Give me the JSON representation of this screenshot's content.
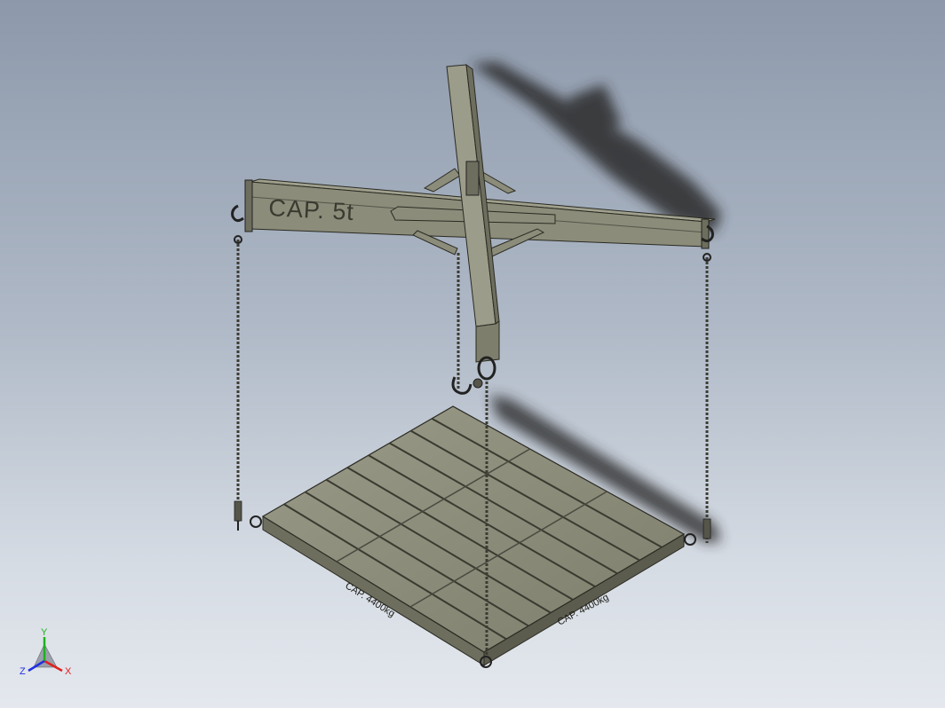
{
  "viewport": {
    "background_top": "#8d99ab",
    "background_bottom": "#e4e8ee"
  },
  "model": {
    "beam_capacity_label": "CAP. 5t",
    "plate_capacity_label_left": "CAP. 4400kg",
    "plate_capacity_label_right": "CAP. 4400kg",
    "steel_color": "#8c8c7a",
    "steel_dark": "#5e5e50",
    "chain_color": "#3c3c34"
  },
  "triad": {
    "x_label": "X",
    "y_label": "Y",
    "z_label": "Z",
    "x_color": "#e02020",
    "y_color": "#20b020",
    "z_color": "#2030e0"
  }
}
